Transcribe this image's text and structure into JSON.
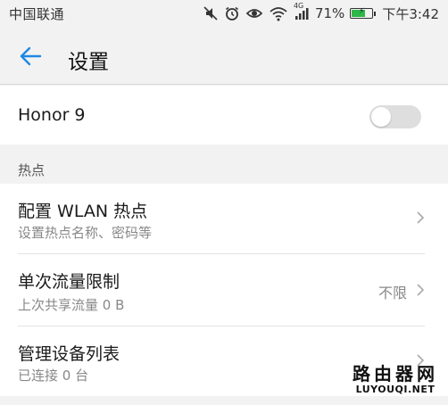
{
  "status_bar": {
    "carrier": "中国联通",
    "network": "4G",
    "battery_percent": "71%",
    "battery_level": 0.71,
    "time": "下午3:42",
    "icons": [
      "mute-icon",
      "alarm-icon",
      "eye-comfort-icon",
      "wifi-icon",
      "signal-icon",
      "battery-icon"
    ]
  },
  "app_bar": {
    "title": "设置",
    "back_icon": "arrow-left-icon"
  },
  "device": {
    "name": "Honor 9",
    "toggle_on": false
  },
  "section": {
    "header": "热点"
  },
  "items": [
    {
      "title": "配置 WLAN 热点",
      "subtitle": "设置热点名称、密码等",
      "value": ""
    },
    {
      "title": "单次流量限制",
      "subtitle": "上次共享流量 0 B",
      "value": "不限"
    },
    {
      "title": "管理设备列表",
      "subtitle": "已连接 0 台",
      "value": ""
    }
  ],
  "watermark": {
    "cn": "路由器网",
    "en": "LUYOUQI.NET"
  },
  "colors": {
    "accent": "#1e88e5",
    "battery": "#2fb84a",
    "background": "#f2f2f2"
  }
}
